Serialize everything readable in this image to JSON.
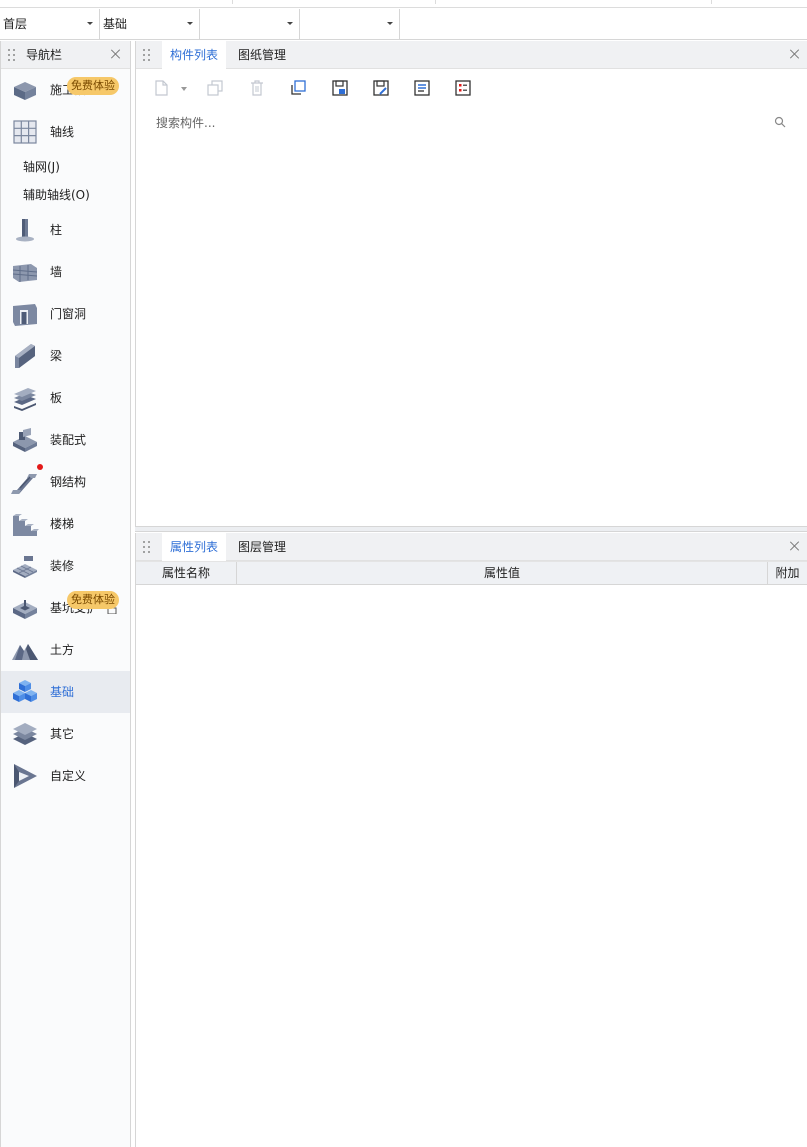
{
  "combos": [
    {
      "value": "首层"
    },
    {
      "value": "基础"
    },
    {
      "value": ""
    },
    {
      "value": ""
    }
  ],
  "nav": {
    "title": "导航栏",
    "items": [
      {
        "label": "施工段",
        "icon": "construction-section-icon",
        "badge": "免费体验"
      },
      {
        "label": "轴线",
        "icon": "grid-axis-icon"
      },
      {
        "label": "柱",
        "icon": "column-icon"
      },
      {
        "label": "墙",
        "icon": "wall-icon"
      },
      {
        "label": "门窗洞",
        "icon": "door-window-icon"
      },
      {
        "label": "梁",
        "icon": "beam-icon"
      },
      {
        "label": "板",
        "icon": "slab-icon"
      },
      {
        "label": "装配式",
        "icon": "prefab-icon"
      },
      {
        "label": "钢结构",
        "icon": "steel-structure-icon",
        "dot": true
      },
      {
        "label": "楼梯",
        "icon": "stairs-icon"
      },
      {
        "label": "装修",
        "icon": "decoration-icon"
      },
      {
        "label": "基坑支护",
        "icon": "pit-support-icon",
        "badge": "免费体验"
      },
      {
        "label": "土方",
        "icon": "earthwork-icon"
      },
      {
        "label": "基础",
        "icon": "foundation-icon",
        "active": true
      },
      {
        "label": "其它",
        "icon": "other-icon"
      },
      {
        "label": "自定义",
        "icon": "custom-icon"
      }
    ],
    "sub_items": [
      "轴网(J)",
      "辅助轴线(O)"
    ]
  },
  "component_panel": {
    "tabs": [
      "构件列表",
      "图纸管理"
    ],
    "search_placeholder": "搜索构件..."
  },
  "property_panel": {
    "tabs": [
      "属性列表",
      "图层管理"
    ],
    "columns": [
      "属性名称",
      "属性值",
      "附加"
    ]
  },
  "colors": {
    "accent": "#2f6fd6",
    "badge": "#f6c869",
    "dot": "#e31919"
  }
}
